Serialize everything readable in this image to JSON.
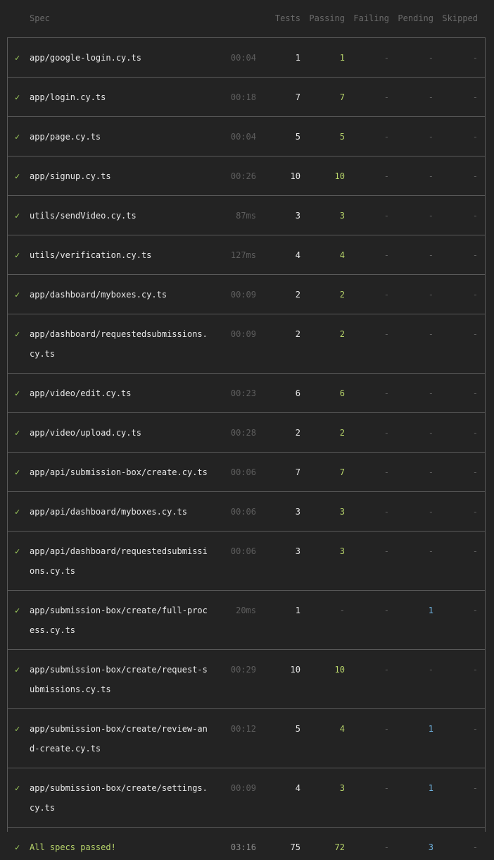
{
  "header": {
    "spec": "Spec",
    "tests": "Tests",
    "passing": "Passing",
    "failing": "Failing",
    "pending": "Pending",
    "skipped": "Skipped"
  },
  "rows": [
    {
      "status": "✓",
      "spec": [
        "app/google-login.cy.ts"
      ],
      "duration": "00:04",
      "tests": "1",
      "passing": "1",
      "failing": "-",
      "pending": "-",
      "skipped": "-"
    },
    {
      "status": "✓",
      "spec": [
        "app/login.cy.ts"
      ],
      "duration": "00:18",
      "tests": "7",
      "passing": "7",
      "failing": "-",
      "pending": "-",
      "skipped": "-"
    },
    {
      "status": "✓",
      "spec": [
        "app/page.cy.ts"
      ],
      "duration": "00:04",
      "tests": "5",
      "passing": "5",
      "failing": "-",
      "pending": "-",
      "skipped": "-"
    },
    {
      "status": "✓",
      "spec": [
        "app/signup.cy.ts"
      ],
      "duration": "00:26",
      "tests": "10",
      "passing": "10",
      "failing": "-",
      "pending": "-",
      "skipped": "-"
    },
    {
      "status": "✓",
      "spec": [
        "utils/sendVideo.cy.ts"
      ],
      "duration": "87ms",
      "tests": "3",
      "passing": "3",
      "failing": "-",
      "pending": "-",
      "skipped": "-"
    },
    {
      "status": "✓",
      "spec": [
        "utils/verification.cy.ts"
      ],
      "duration": "127ms",
      "tests": "4",
      "passing": "4",
      "failing": "-",
      "pending": "-",
      "skipped": "-"
    },
    {
      "status": "✓",
      "spec": [
        "app/dashboard/myboxes.cy.ts"
      ],
      "duration": "00:09",
      "tests": "2",
      "passing": "2",
      "failing": "-",
      "pending": "-",
      "skipped": "-"
    },
    {
      "status": "✓",
      "spec": [
        "app/dashboard/requestedsubmissions.",
        "cy.ts"
      ],
      "duration": "00:09",
      "tests": "2",
      "passing": "2",
      "failing": "-",
      "pending": "-",
      "skipped": "-"
    },
    {
      "status": "✓",
      "spec": [
        "app/video/edit.cy.ts"
      ],
      "duration": "00:23",
      "tests": "6",
      "passing": "6",
      "failing": "-",
      "pending": "-",
      "skipped": "-"
    },
    {
      "status": "✓",
      "spec": [
        "app/video/upload.cy.ts"
      ],
      "duration": "00:28",
      "tests": "2",
      "passing": "2",
      "failing": "-",
      "pending": "-",
      "skipped": "-"
    },
    {
      "status": "✓",
      "spec": [
        "app/api/submission-box/create.cy.ts"
      ],
      "duration": "00:06",
      "tests": "7",
      "passing": "7",
      "failing": "-",
      "pending": "-",
      "skipped": "-"
    },
    {
      "status": "✓",
      "spec": [
        "app/api/dashboard/myboxes.cy.ts"
      ],
      "duration": "00:06",
      "tests": "3",
      "passing": "3",
      "failing": "-",
      "pending": "-",
      "skipped": "-"
    },
    {
      "status": "✓",
      "spec": [
        "app/api/dashboard/requestedsubmissi",
        "ons.cy.ts"
      ],
      "duration": "00:06",
      "tests": "3",
      "passing": "3",
      "failing": "-",
      "pending": "-",
      "skipped": "-"
    },
    {
      "status": "✓",
      "spec": [
        "app/submission-box/create/full-proc",
        "ess.cy.ts"
      ],
      "duration": "20ms",
      "tests": "1",
      "passing": "-",
      "failing": "-",
      "pending": "1",
      "skipped": "-"
    },
    {
      "status": "✓",
      "spec": [
        "app/submission-box/create/request-s",
        "ubmissions.cy.ts"
      ],
      "duration": "00:29",
      "tests": "10",
      "passing": "10",
      "failing": "-",
      "pending": "-",
      "skipped": "-"
    },
    {
      "status": "✓",
      "spec": [
        "app/submission-box/create/review-an",
        "d-create.cy.ts"
      ],
      "duration": "00:12",
      "tests": "5",
      "passing": "4",
      "failing": "-",
      "pending": "1",
      "skipped": "-"
    },
    {
      "status": "✓",
      "spec": [
        "app/submission-box/create/settings.",
        "cy.ts"
      ],
      "duration": "00:09",
      "tests": "4",
      "passing": "3",
      "failing": "-",
      "pending": "1",
      "skipped": "-"
    }
  ],
  "summary": {
    "status": "✓",
    "label": "All specs passed!",
    "duration": "03:16",
    "tests": "75",
    "passing": "72",
    "failing": "-",
    "pending": "3",
    "skipped": "-"
  },
  "colors": {
    "background": "#232323",
    "pass_green": "#b7d46a",
    "pending_blue": "#6fb3e0",
    "border": "#5a5a5a",
    "muted": "#5e5e5e"
  }
}
